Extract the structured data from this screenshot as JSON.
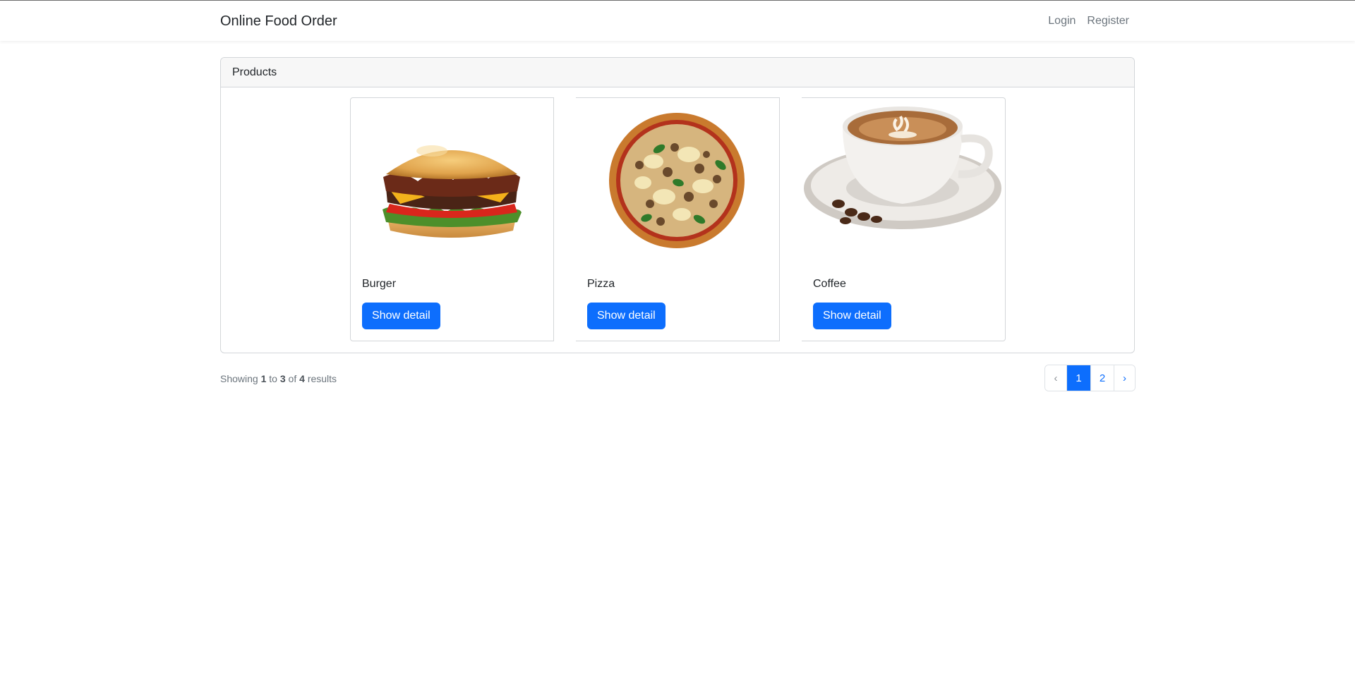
{
  "navbar": {
    "brand": "Online Food Order",
    "links": [
      "Login",
      "Register"
    ]
  },
  "panel": {
    "title": "Products"
  },
  "products": [
    {
      "name": "Burger",
      "image": "burger-photo",
      "button": "Show detail"
    },
    {
      "name": "Pizza",
      "image": "pizza-photo",
      "button": "Show detail"
    },
    {
      "name": "Coffee",
      "image": "coffee-cup-photo",
      "button": "Show detail"
    }
  ],
  "results": {
    "prefix": "Showing",
    "from": "1",
    "to_word": "to",
    "to": "3",
    "of_word": "of",
    "total": "4",
    "suffix": "results"
  },
  "pagination": {
    "prev": "‹",
    "pages": [
      "1",
      "2"
    ],
    "active": "1",
    "next": "›"
  },
  "colors": {
    "primary": "#0d6efd",
    "muted": "#6c757d",
    "border": "#d3d6d9",
    "header_bg": "#f7f7f7"
  }
}
